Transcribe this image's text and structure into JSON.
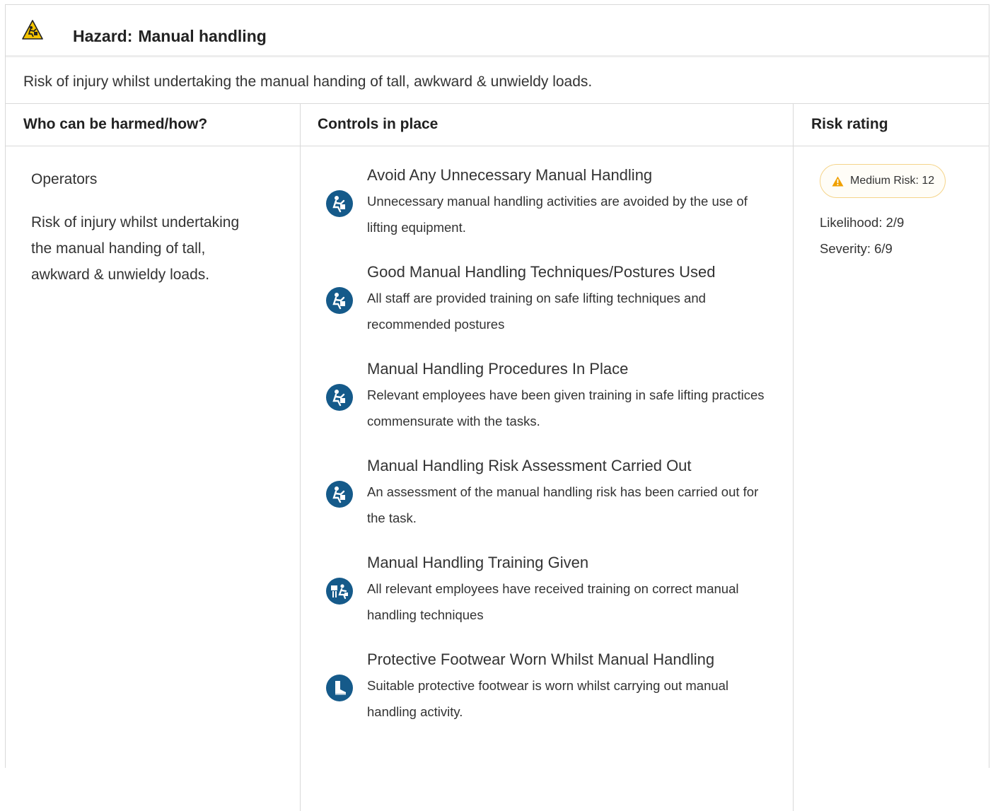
{
  "hazard": {
    "label": "Hazard:",
    "name": "Manual handling",
    "description": "Risk of injury whilst undertaking the manual handing of tall, awkward & unwieldy loads."
  },
  "columns": {
    "who": "Who can be harmed/how?",
    "controls": "Controls in place",
    "risk": "Risk rating"
  },
  "who": {
    "group": "Operators",
    "text": "Risk of injury whilst undertaking the manual handing of tall, awkward & unwieldy loads."
  },
  "controls": [
    {
      "title": "Avoid Any Unnecessary Manual Handling",
      "desc": "Unnecessary manual handling activities are avoided by the use of lifting equipment.",
      "icon": "manual-handling-icon"
    },
    {
      "title": "Good Manual Handling Techniques/Postures Used",
      "desc": "All staff are provided training on safe lifting techniques and recommended postures",
      "icon": "manual-handling-icon"
    },
    {
      "title": "Manual Handling Procedures In Place",
      "desc": "Relevant employees have been given training in safe lifting practices commensurate with the tasks.",
      "icon": "manual-handling-icon"
    },
    {
      "title": "Manual Handling Risk Assessment Carried Out",
      "desc": "An assessment of the manual handling risk has been carried out for the task.",
      "icon": "manual-handling-icon"
    },
    {
      "title": "Manual Handling Training Given",
      "desc": "All relevant employees have received training on correct manual handling techniques",
      "icon": "training-icon"
    },
    {
      "title": "Protective Footwear Worn Whilst Manual Handling",
      "desc": "Suitable protective footwear is worn whilst carrying out manual handling activity.",
      "icon": "boot-icon"
    }
  ],
  "risk": {
    "badge": "Medium Risk: 12",
    "likelihood": "Likelihood: 2/9",
    "severity": "Severity: 6/9"
  },
  "colors": {
    "icon_blue": "#155a8a",
    "warning_yellow": "#f5c400",
    "medium_risk": "#f0a000"
  }
}
